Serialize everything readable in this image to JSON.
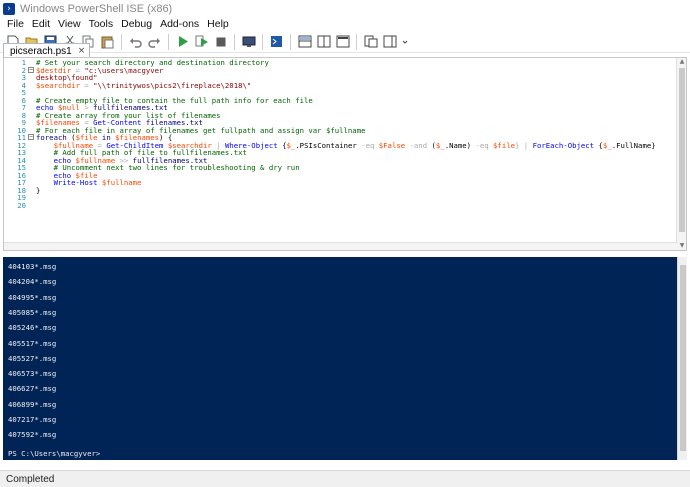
{
  "window": {
    "title": "Windows PowerShell ISE (x86)",
    "icon": "powershell-icon"
  },
  "menu": [
    "File",
    "Edit",
    "View",
    "Tools",
    "Debug",
    "Add-ons",
    "Help"
  ],
  "toolbar": {
    "buttons": [
      "new-file-icon",
      "open-icon",
      "save-icon",
      "cut-icon",
      "copy-icon",
      "paste-icon",
      "undo-icon",
      "redo-icon",
      "run-icon",
      "run-selection-icon",
      "stop-icon",
      "remote-powershell-icon",
      "powershell-console-icon",
      "show-script-top-icon",
      "show-script-right-icon",
      "show-script-max-icon",
      "show-command-window-icon",
      "show-addon-icon"
    ],
    "colors": {
      "run": "#2ea043",
      "stop": "#5a5a5a",
      "accent": "#1e5aa8"
    }
  },
  "tab": {
    "label": "picserach.ps1",
    "close": "×"
  },
  "editor": {
    "line_numbers": [
      "1",
      "2",
      "3",
      "4",
      "5",
      "6",
      "7",
      "8",
      "9",
      "10",
      "11",
      "12",
      "13",
      "14",
      "15",
      "16",
      "17",
      "18",
      "19",
      "20"
    ],
    "lines": [
      [
        {
          "t": "# Set your search directory and destination directory",
          "c": "comment"
        }
      ],
      [
        {
          "t": "$destdir",
          "c": "var"
        },
        {
          "t": " = ",
          "c": "op"
        },
        {
          "t": "\"c:\\users\\macgyver",
          "c": "str"
        }
      ],
      [
        {
          "t": "desktop\\found\"",
          "c": "str"
        }
      ],
      [
        {
          "t": "$searchdir",
          "c": "var"
        },
        {
          "t": " = ",
          "c": "op"
        },
        {
          "t": "\"\\\\trinitywos\\pics2\\fireplace\\2018\\\"",
          "c": "str"
        }
      ],
      [],
      [
        {
          "t": "# Create empty file to contain the full path info for each file",
          "c": "comment"
        }
      ],
      [
        {
          "t": "echo ",
          "c": "cmd"
        },
        {
          "t": "$null",
          "c": "var"
        },
        {
          "t": " > ",
          "c": "op"
        },
        {
          "t": "fullfilenames.txt",
          "c": "param"
        }
      ],
      [
        {
          "t": "# Create array from your list of filenames",
          "c": "comment"
        }
      ],
      [
        {
          "t": "$filenames",
          "c": "var"
        },
        {
          "t": " = ",
          "c": "op"
        },
        {
          "t": "Get-Content ",
          "c": "cmd"
        },
        {
          "t": "filenames.txt",
          "c": "param"
        }
      ],
      [
        {
          "t": "# For each file in array of filenames get fullpath and assign var $fullname",
          "c": "comment"
        }
      ],
      [
        {
          "t": "foreach ",
          "c": "kw"
        },
        {
          "t": "(",
          "c": "plain"
        },
        {
          "t": "$file",
          "c": "var"
        },
        {
          "t": " in ",
          "c": "kw"
        },
        {
          "t": "$filenames",
          "c": "var"
        },
        {
          "t": ") {",
          "c": "plain"
        }
      ],
      [
        {
          "t": "    ",
          "c": "plain"
        },
        {
          "t": "$fullname",
          "c": "var"
        },
        {
          "t": " = ",
          "c": "op"
        },
        {
          "t": "Get-ChildItem ",
          "c": "cmd"
        },
        {
          "t": "$searchdir",
          "c": "var"
        },
        {
          "t": " | ",
          "c": "op"
        },
        {
          "t": "Where-Object ",
          "c": "cmd"
        },
        {
          "t": "{",
          "c": "plain"
        },
        {
          "t": "$_",
          "c": "var"
        },
        {
          "t": ".PSIsContainer ",
          "c": "plain"
        },
        {
          "t": "-eq ",
          "c": "op"
        },
        {
          "t": "$False",
          "c": "var"
        },
        {
          "t": " -and ",
          "c": "op"
        },
        {
          "t": "(",
          "c": "plain"
        },
        {
          "t": "$_",
          "c": "var"
        },
        {
          "t": ".Name) ",
          "c": "plain"
        },
        {
          "t": "-eq ",
          "c": "op"
        },
        {
          "t": "$file",
          "c": "var"
        },
        {
          "t": "} | ",
          "c": "op"
        },
        {
          "t": "ForEach-Object ",
          "c": "cmd"
        },
        {
          "t": "{",
          "c": "plain"
        },
        {
          "t": "$_",
          "c": "var"
        },
        {
          "t": ".FullName}",
          "c": "plain"
        }
      ],
      [
        {
          "t": "    ",
          "c": "plain"
        },
        {
          "t": "# Add full path of file to fullfilenames.txt",
          "c": "comment"
        }
      ],
      [
        {
          "t": "    ",
          "c": "plain"
        },
        {
          "t": "echo ",
          "c": "cmd"
        },
        {
          "t": "$fullname",
          "c": "var"
        },
        {
          "t": " >> ",
          "c": "op"
        },
        {
          "t": "fullfilenames.txt",
          "c": "param"
        }
      ],
      [
        {
          "t": "    ",
          "c": "plain"
        },
        {
          "t": "# Uncomment next two lines for troubleshooting & dry run",
          "c": "comment"
        }
      ],
      [
        {
          "t": "    ",
          "c": "plain"
        },
        {
          "t": "echo ",
          "c": "cmd"
        },
        {
          "t": "$file",
          "c": "var"
        }
      ],
      [
        {
          "t": "    ",
          "c": "plain"
        },
        {
          "t": "Write-Host ",
          "c": "cmd"
        },
        {
          "t": "$fullname",
          "c": "var"
        }
      ],
      [
        {
          "t": "}",
          "c": "plain"
        }
      ],
      [],
      []
    ],
    "colors": {
      "comment": "#006400",
      "var": "#ff4500",
      "str": "#8b0000",
      "cmd": "#0000ff",
      "op": "#a9a9a9",
      "kw": "#00008b",
      "param": "#000080",
      "plain": "#000000"
    }
  },
  "console": {
    "background": "#012456",
    "output": [
      "404103*.msg",
      "404204*.msg",
      "404995*.msg",
      "405085*.msg",
      "405246*.msg",
      "405517*.msg",
      "405527*.msg",
      "406573*.msg",
      "406627*.msg",
      "406899*.msg",
      "407217*.msg",
      "407592*.msg"
    ],
    "prompt": "PS C:\\Users\\macgyver>"
  },
  "status": {
    "text": "Completed"
  }
}
